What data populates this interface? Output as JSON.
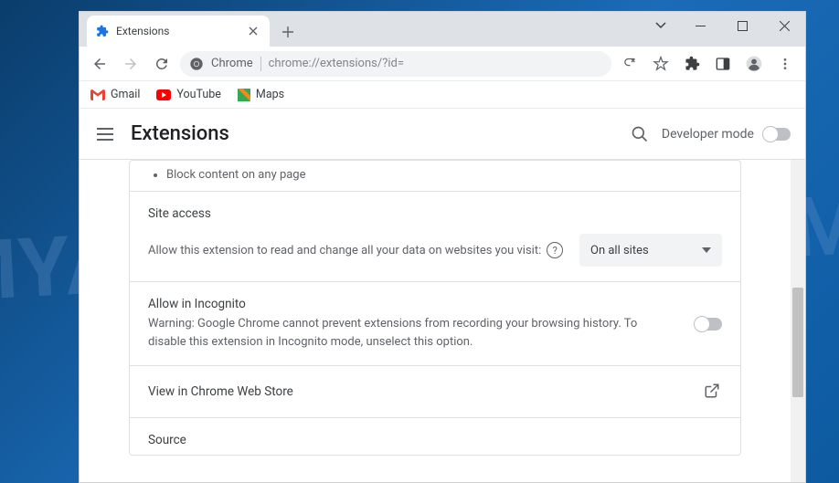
{
  "watermark": "MYANTISPYWARE.COM",
  "tab": {
    "title": "Extensions"
  },
  "omnibox": {
    "label": "Chrome",
    "url": "chrome://extensions/?id="
  },
  "bookmarks": [
    {
      "label": "Gmail"
    },
    {
      "label": "YouTube"
    },
    {
      "label": "Maps"
    }
  ],
  "header": {
    "title": "Extensions",
    "devmode_label": "Developer mode"
  },
  "permissions": {
    "bullet": "Block content on any page"
  },
  "siteaccess": {
    "title": "Site access",
    "prompt": "Allow this extension to read and change all your data on websites you visit:",
    "selected": "On all sites"
  },
  "incognito": {
    "title": "Allow in Incognito",
    "desc": "Warning: Google Chrome cannot prevent extensions from recording your browsing history. To disable this extension in Incognito mode, unselect this option."
  },
  "webstore": {
    "label": "View in Chrome Web Store"
  },
  "source": {
    "title": "Source"
  }
}
